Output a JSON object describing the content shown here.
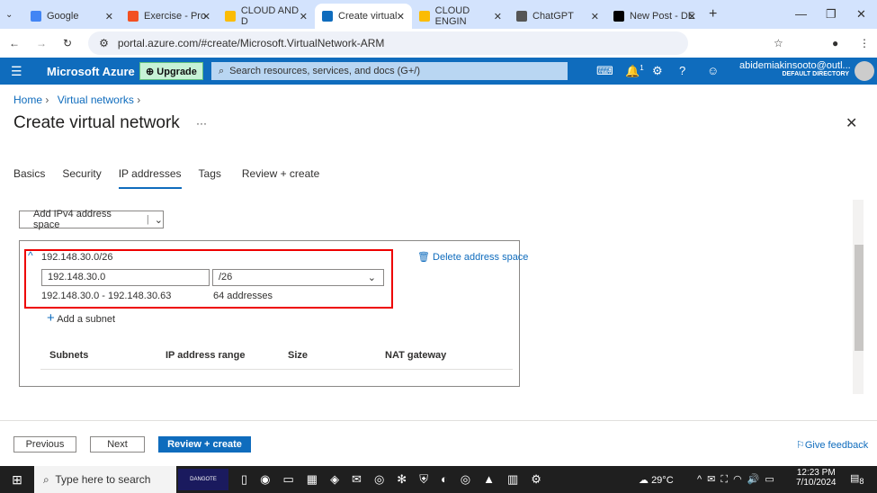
{
  "browser": {
    "tabs": [
      {
        "label": "Google",
        "color": "#4285f4"
      },
      {
        "label": "Exercise - Pro",
        "color": "#f25022"
      },
      {
        "label": "CLOUD AND D",
        "color": "#fbbc04"
      },
      {
        "label": "Create virtual",
        "color": "#0f6cbd",
        "active": true
      },
      {
        "label": "CLOUD ENGIN",
        "color": "#fbbc04"
      },
      {
        "label": "ChatGPT",
        "color": "#555"
      },
      {
        "label": "New Post - DE",
        "color": "#000"
      }
    ],
    "url": "portal.azure.com/#create/Microsoft.VirtualNetwork-ARM"
  },
  "azure": {
    "brand": "Microsoft Azure",
    "upgrade": "Upgrade",
    "search_placeholder": "Search resources, services, and docs (G+/)",
    "notif_count": "1",
    "user": "abidemiakinsooto@outl...",
    "directory": "DEFAULT DIRECTORY",
    "accent": "#0f6cbd"
  },
  "breadcrumb": [
    "Home",
    "Virtual networks"
  ],
  "title": "Create virtual network",
  "more": "···",
  "page_tabs": [
    "Basics",
    "Security",
    "IP addresses",
    "Tags",
    "Review + create"
  ],
  "add_space": "Add IPv4 address space",
  "space": {
    "cidr": "192.148.30.0/26",
    "address": "192.148.30.0",
    "prefix": "/26",
    "range": "192.148.30.0 - 192.148.30.63",
    "count": "64 addresses",
    "delete": "Delete address space",
    "add_subnet": "Add a subnet"
  },
  "subnet_headers": [
    "Subnets",
    "IP address range",
    "Size",
    "NAT gateway"
  ],
  "footer": {
    "previous": "Previous",
    "next": "Next",
    "review": "Review + create",
    "feedback": "Give feedback"
  },
  "taskbar": {
    "search": "Type here to search",
    "weather": "29°C",
    "time": "12:23 PM",
    "date": "7/10/2024",
    "badge": "8",
    "notif": "DANGOTE"
  }
}
